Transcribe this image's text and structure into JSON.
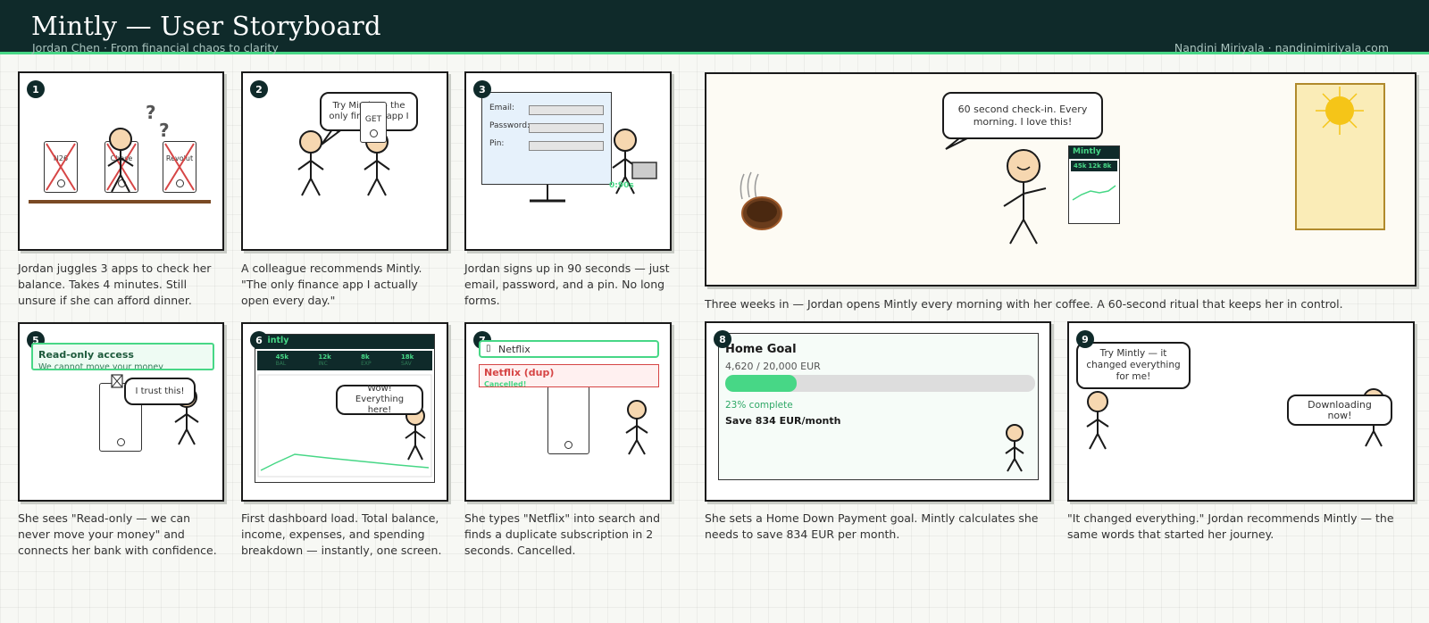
{
  "header": {
    "title": "Mintly — User Storyboard",
    "subtitle": "Jordan Chen  ·  From financial chaos to clarity",
    "credit": "Nandini Miriyala  ·  nandinimiriyala.com"
  },
  "colors": {
    "header_bg": "#0f2a2a",
    "accent": "#47d786",
    "danger": "#d64545",
    "sun": "#f5c518"
  },
  "panels": [
    {
      "num": "1",
      "caption": "Jordan juggles 3 apps to check her balance. Takes 4 minutes. Still unsure if she can afford dinner.",
      "apps": [
        "N26",
        "Chase",
        "Revolut"
      ],
      "glyph": "?"
    },
    {
      "num": "2",
      "caption": "A colleague recommends Mintly. \"The only finance app I actually open every day.\"",
      "bubble": "Try Mintly — the only finance app I",
      "phone_label": "GET"
    },
    {
      "num": "3",
      "caption": "Jordan signs up in 90 seconds — just email, password, and a pin. No long forms.",
      "fields": [
        "Email:",
        "Password:",
        "Pin:"
      ],
      "timer": "0:90s"
    },
    {
      "num": "4",
      "caption": "Three weeks in — Jordan opens Mintly every morning with her coffee. A 60-second ritual that keeps her in control.",
      "bubble": "60 second check-in. Every morning. I love this!"
    },
    {
      "num": "5",
      "caption": "She sees \"Read-only — we can never move your money\" and connects her bank with confidence.",
      "banner_title": "Read-only access",
      "banner_sub": "We cannot move your money",
      "bubble": "I trust this!"
    },
    {
      "num": "6",
      "caption": "First dashboard load. Total balance, income, expenses, and spending breakdown — instantly, one screen.",
      "bubble": "Wow! Everything here!"
    },
    {
      "num": "7",
      "caption": "She types \"Netflix\" into search and finds a duplicate subscription in 2 seconds. Cancelled.",
      "search_value": "Netflix",
      "search_icon": "▯",
      "dup_title": "Netflix (dup)",
      "dup_status": "Cancelled!"
    },
    {
      "num": "8",
      "caption": "She sets a Home Down Payment goal. Mintly calculates she needs to save 834 EUR per month.",
      "goal_title": "Home Goal",
      "goal_amount": "4,620 / 20,000 EUR",
      "goal_progress": 0.23,
      "goal_pct_label": "23% complete",
      "goal_save": "Save 834 EUR/month"
    },
    {
      "num": "9",
      "caption": "\"It changed everything.\" Jordan recommends Mintly — the same words that started her journey.",
      "bubble_left": "Try Mintly — it changed everything for me!",
      "bubble_right": "Downloading now!"
    }
  ],
  "dashboard": {
    "brand": "Mintly",
    "stats": [
      {
        "value": "45k",
        "label": "BAL"
      },
      {
        "value": "12k",
        "label": "INC"
      },
      {
        "value": "8k",
        "label": "EXP"
      },
      {
        "value": "18k",
        "label": "SAV"
      }
    ]
  }
}
